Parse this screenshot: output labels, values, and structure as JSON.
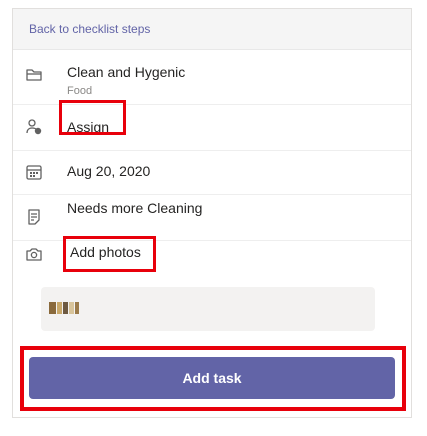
{
  "header": {
    "back_label": "Back to checklist steps"
  },
  "details": {
    "category": {
      "title": "Clean and Hygenic",
      "subtitle": "Food",
      "icon": "folder-icon"
    },
    "assign": {
      "label": "Assign",
      "icon": "assign-person-icon"
    },
    "date": {
      "value": "Aug 20, 2020",
      "icon": "calendar-icon"
    },
    "note": {
      "value": "Needs more Cleaning",
      "icon": "notes-icon"
    },
    "photos": {
      "label": "Add photos",
      "icon": "camera-icon"
    }
  },
  "footer": {
    "add_task_label": "Add task"
  },
  "colors": {
    "accent": "#6264a7",
    "highlight": "#e8000b"
  }
}
